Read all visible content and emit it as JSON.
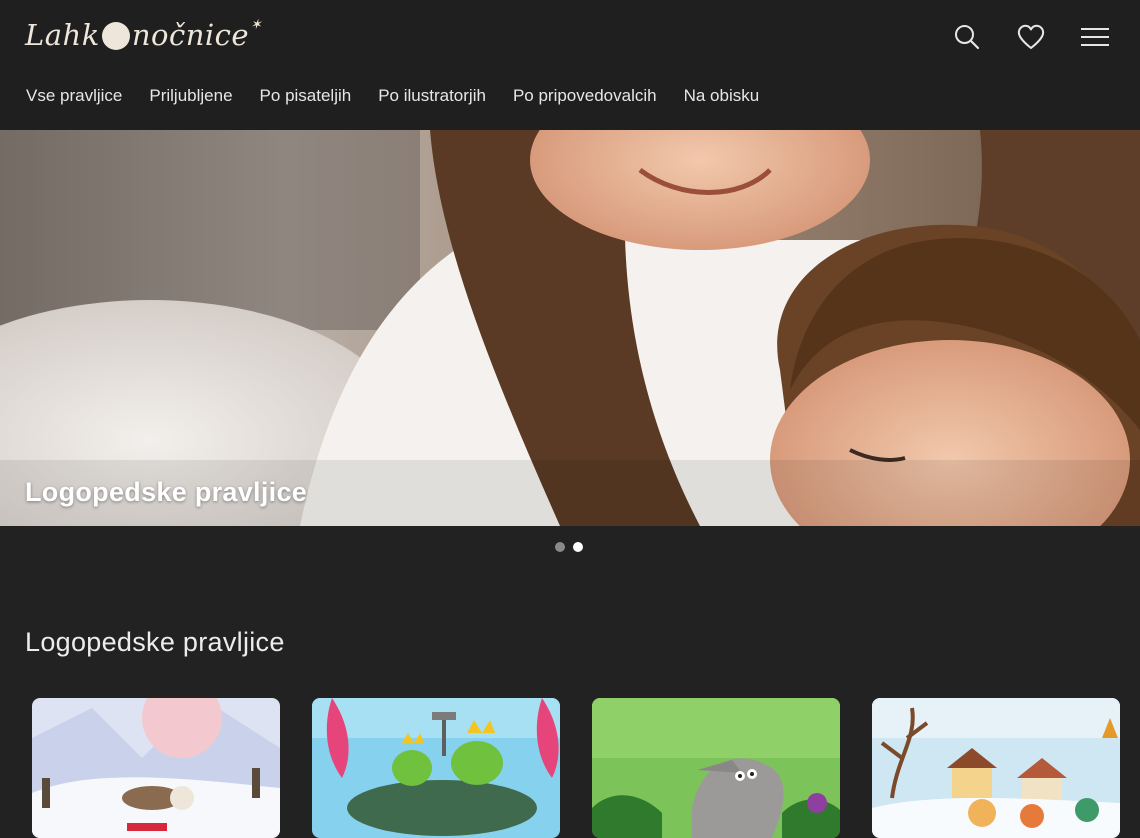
{
  "header": {
    "logo_text_left": "Lahk",
    "logo_text_right": "nočnice",
    "icons": [
      "search-icon",
      "heart-icon",
      "menu-icon"
    ]
  },
  "nav": {
    "items": [
      {
        "label": "Vse pravljice"
      },
      {
        "label": "Priljubljene"
      },
      {
        "label": "Po pisateljih"
      },
      {
        "label": "Po ilustratorjih"
      },
      {
        "label": "Po pripovedovalcih"
      },
      {
        "label": "Na obisku"
      }
    ]
  },
  "hero": {
    "title": "Logopedske pravljice",
    "slides": 2,
    "active_slide": 2
  },
  "section": {
    "title": "Logopedske pravljice"
  },
  "colors": {
    "background": "#222222",
    "header": "#1f1f1f",
    "logo": "#eee6da",
    "dot_inactive": "#8a8a8a",
    "dot_active": "#ffffff"
  }
}
